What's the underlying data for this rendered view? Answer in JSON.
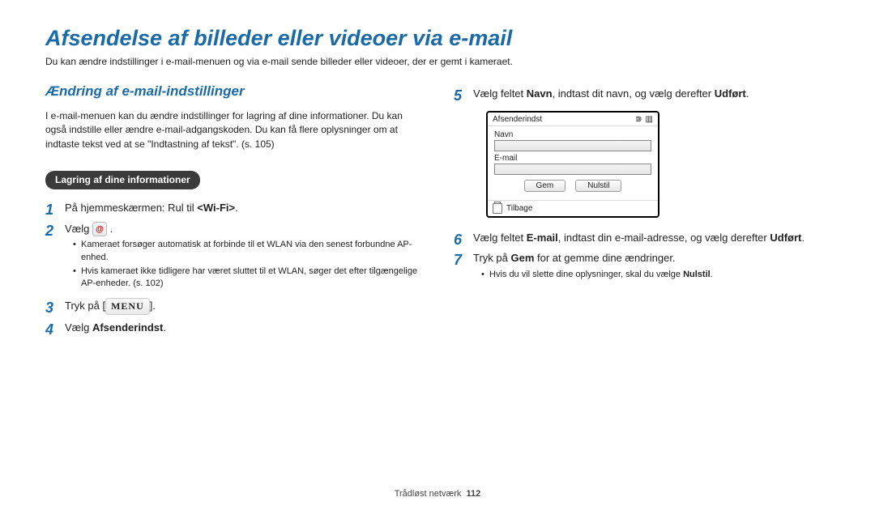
{
  "title": "Afsendelse af billeder eller videoer via e-mail",
  "intro": "Du kan ændre indstillinger i e-mail-menuen og via e-mail sende billeder eller videoer, der er gemt i kameraet.",
  "left": {
    "subhead": "Ændring af e-mail-indstillinger",
    "body": "I e-mail-menuen kan du ændre indstillinger for lagring af dine informationer. Du kan også indstille eller ændre e-mail-adgangskoden. Du kan få flere oplysninger om at indtaste tekst ved at se \"Indtastning af tekst\". (s. 105)",
    "pill": "Lagring af dine informationer",
    "steps": {
      "s1_pre": "På hjemmeskærmen: Rul til ",
      "s1_bold": "<Wi-Fi>",
      "s1_post": ".",
      "s2": "Vælg ",
      "s2_bullets": [
        "Kameraet forsøger automatisk at forbinde til et WLAN via den senest forbundne AP-enhed.",
        "Hvis kameraet ikke tidligere har været sluttet til et WLAN, søger det efter tilgængelige AP-enheder. (s. 102)"
      ],
      "s3_pre": "Tryk på [",
      "s3_menu": "MENU",
      "s3_post": "].",
      "s4_pre": "Vælg ",
      "s4_bold": "Afsenderindst",
      "s4_post": "."
    }
  },
  "right": {
    "s5_pre": "Vælg feltet ",
    "s5_b1": "Navn",
    "s5_mid": ", indtast dit navn, og vælg derefter ",
    "s5_b2": "Udført",
    "s5_post": ".",
    "device": {
      "title": "Afsenderindst",
      "label1": "Navn",
      "label2": "E-mail",
      "btn1": "Gem",
      "btn2": "Nulstil",
      "back": "Tilbage"
    },
    "s6_pre": "Vælg feltet ",
    "s6_b1": "E-mail",
    "s6_mid": ", indtast din e-mail-adresse, og vælg derefter ",
    "s6_b2": "Udført",
    "s6_post": ".",
    "s7_pre": "Tryk på ",
    "s7_b": "Gem",
    "s7_post": " for at gemme dine ændringer.",
    "s7_bullets_pre": "Hvis du vil slette dine oplysninger, skal du vælge ",
    "s7_bullets_b": "Nulstil",
    "s7_bullets_post": "."
  },
  "footer": {
    "section": "Trådløst netværk",
    "page": "112"
  }
}
